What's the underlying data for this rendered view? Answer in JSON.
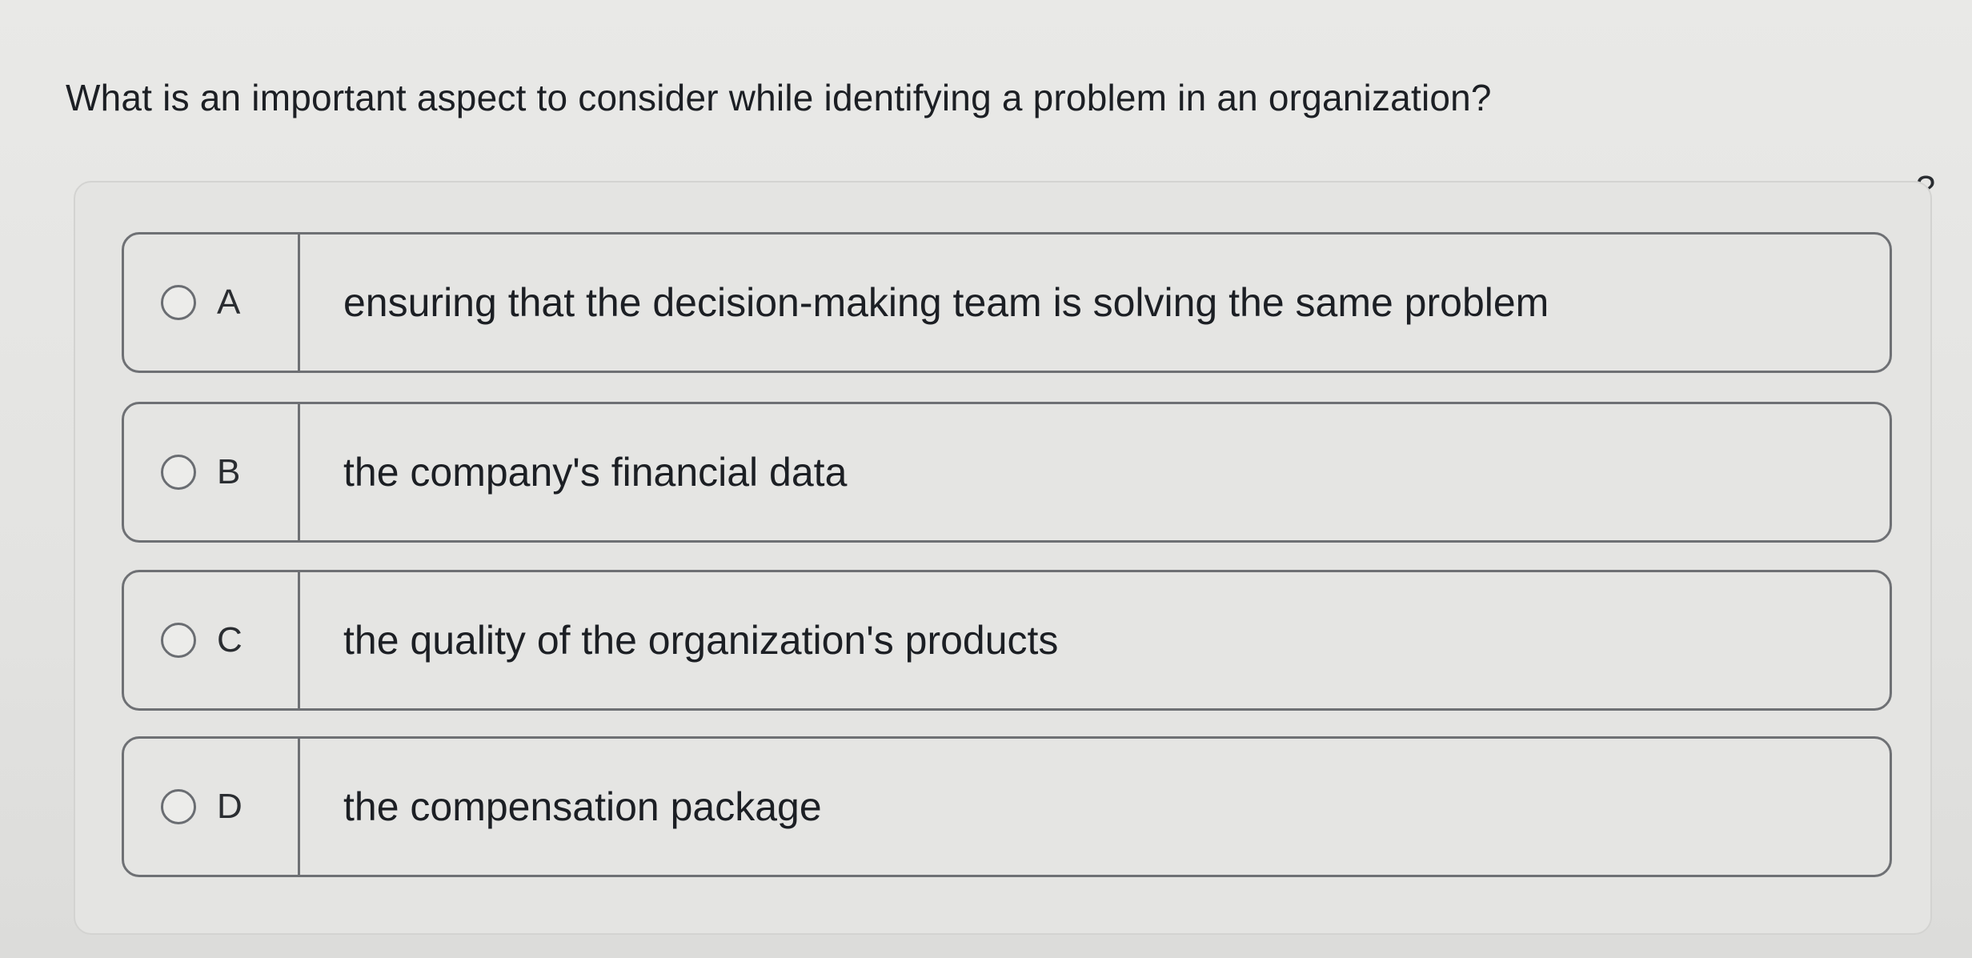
{
  "question": {
    "text": "What is an important aspect to consider while identifying a problem in an organization?"
  },
  "help": {
    "icon": "question-icon",
    "glyph": "?"
  },
  "options": [
    {
      "letter": "A",
      "text": "ensuring that the decision-making team is solving the same problem"
    },
    {
      "letter": "B",
      "text": "the company's financial data"
    },
    {
      "letter": "C",
      "text": "the quality of the organization's products"
    },
    {
      "letter": "D",
      "text": "the compensation package"
    }
  ],
  "colors": {
    "background": "#e6e6e4",
    "border": "#6e7074",
    "text": "#1c1f24"
  }
}
